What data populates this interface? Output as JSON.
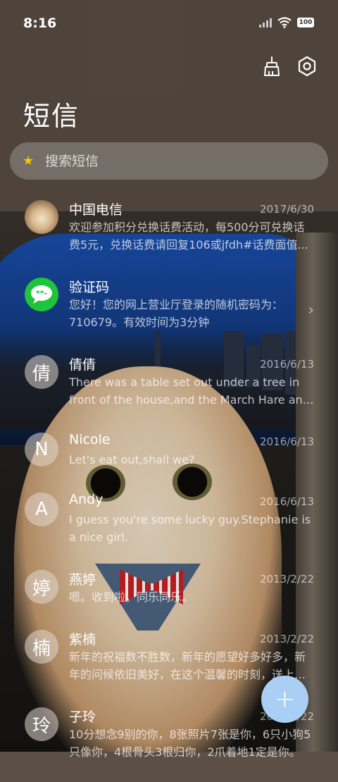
{
  "status_bar": {
    "time": "8:16",
    "battery": "100"
  },
  "header": {
    "title": "短信",
    "clean_icon": "broom-icon",
    "settings_icon": "gear-icon"
  },
  "search": {
    "placeholder": "搜索短信",
    "icon": "star-icon"
  },
  "messages": [
    {
      "name": "中国电信",
      "date": "2017/6/30",
      "snippet": "欢迎参加积分兑换话费活动，每500分可兑换话费5元，兑换话费请回复106或jfdh#话费面值...",
      "avatar": "cat-photo"
    },
    {
      "name": "验证码",
      "date": "",
      "snippet": "您好！您的网上营业厅登录的随机密码为：710679。有效时间为3分钟",
      "avatar": "message-icon"
    },
    {
      "name": "倩倩",
      "date": "2016/6/13",
      "snippet": "There was a table set out under a tree in front of the house,and the March Hare and the Hatter...",
      "avatar_text": "倩"
    },
    {
      "name": "Nicole",
      "date": "2016/6/13",
      "snippet": "Let's eat out,shall we?",
      "avatar_text": "N"
    },
    {
      "name": "Andy",
      "date": "2016/6/13",
      "snippet": "I guess you're some lucky guy.Stephanie is a nice girl.",
      "avatar_text": "A"
    },
    {
      "name": "燕婷",
      "date": "2013/2/22",
      "snippet": "嗯。收到啦。同乐同乐。",
      "avatar_text": "婷"
    },
    {
      "name": "紫楠",
      "date": "2013/2/22",
      "snippet": "新年的祝福数不胜数，新年的愿望好多好多，新年的问候依旧美好，在这个温馨的时刻，送上我的祝福...",
      "avatar_text": "楠"
    },
    {
      "name": "子玲",
      "date": "2013/2/22",
      "snippet": "10分想念9别的你，8张照片7张是你，6只小狗5只像你，4根骨头3根归你，2爪着地1定是你。",
      "avatar_text": "玲"
    }
  ],
  "fab": {
    "label": "+"
  }
}
